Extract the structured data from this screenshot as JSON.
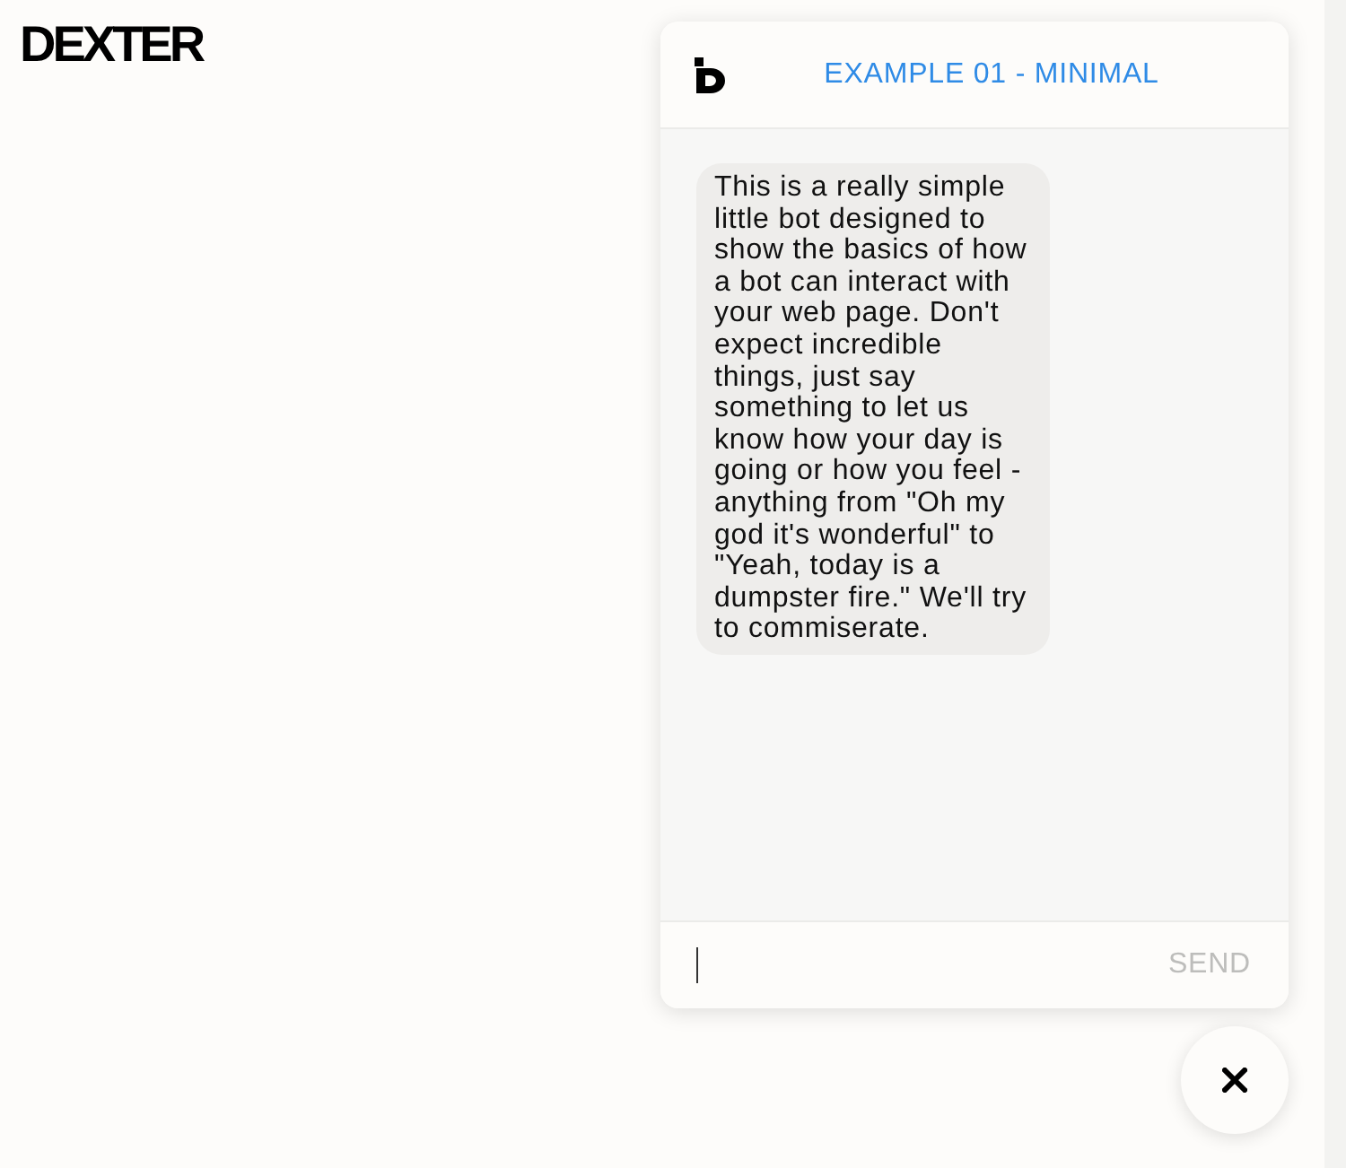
{
  "page": {
    "logo": "DEXTER"
  },
  "chat": {
    "open": true,
    "title": "EXAMPLE 01 - MINIMAL",
    "messages": [
      {
        "kind": "bot",
        "text": "This is a really simple little bot designed to show the basics of how a bot can interact with your web page. Don't expect incredible things, just say something to let us know how your day is going or how you feel - anything from \"Oh my god it's wonderful\" to \"Yeah, today is a dumpster fire.\" We'll try to commiserate."
      }
    ],
    "composer": {
      "send": "SEND",
      "send_disabled": true
    }
  }
}
